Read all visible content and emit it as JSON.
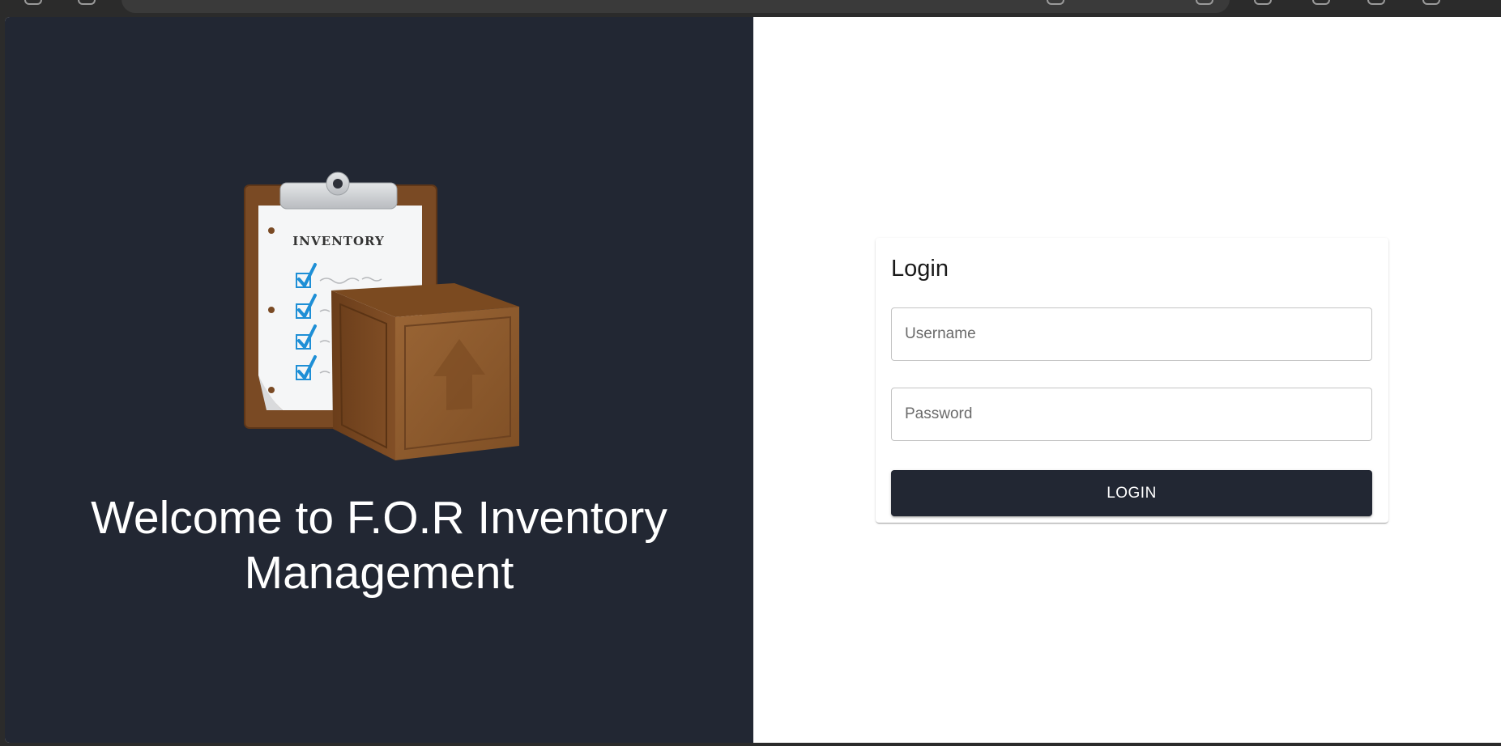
{
  "welcome": {
    "heading": "Welcome to F.O.R Inventory Management",
    "illustration": {
      "icon": "inventory-clipboard-box",
      "clipboard_label": "INVENTORY"
    }
  },
  "login": {
    "title": "Login",
    "username": {
      "placeholder": "Username",
      "value": ""
    },
    "password": {
      "placeholder": "Password",
      "value": ""
    },
    "button_label": "LOGIN"
  },
  "colors": {
    "panel_dark": "#222733",
    "button_bg": "#222733",
    "button_text": "#ffffff",
    "clipboard_brown": "#7a4a24",
    "box_brown": "#8b5a2b",
    "check_blue": "#1e8fd6"
  }
}
